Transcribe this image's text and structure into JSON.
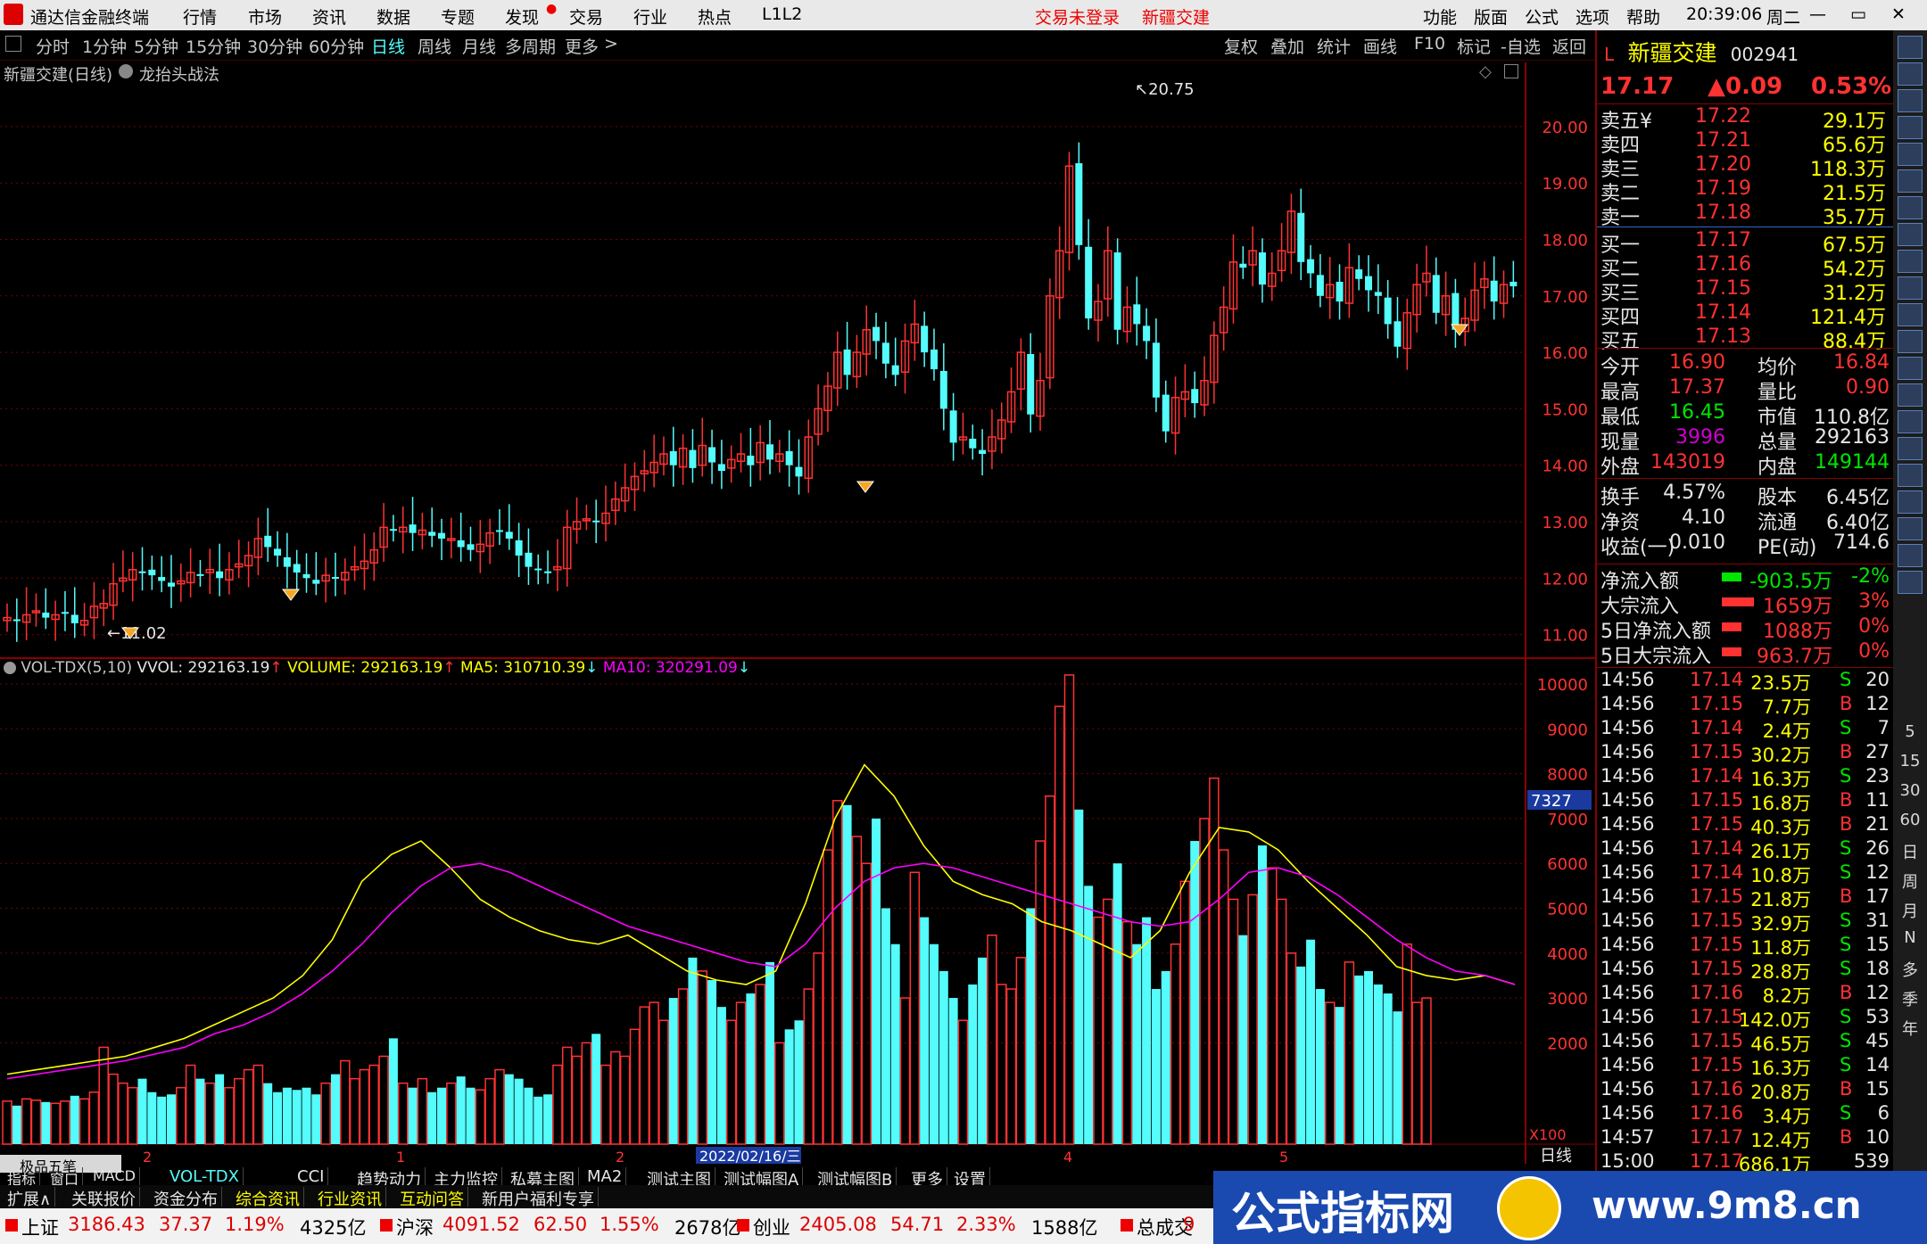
{
  "menu": {
    "title": "通达信金融终端",
    "items": [
      "行情",
      "市场",
      "资讯",
      "数据",
      "专题",
      "发现",
      "交易",
      "行业",
      "热点",
      "L1L2"
    ],
    "center": [
      "交易未登录",
      "新疆交建"
    ],
    "right": [
      "功能",
      "版面",
      "公式",
      "选项",
      "帮助"
    ],
    "time": "20:39:06",
    "weekday": "周二",
    "win_buttons": [
      "—",
      "▭",
      "✕"
    ]
  },
  "toolbar": {
    "periods": [
      "分时",
      "1分钟",
      "5分钟",
      "15分钟",
      "30分钟",
      "60分钟",
      "日线",
      "周线",
      "月线",
      "多周期",
      "更多"
    ],
    "active": "日线",
    "more_arrow": ">",
    "buttons": [
      "复权",
      "叠加",
      "统计",
      "画线",
      "F10",
      "标记",
      "-自选",
      "返回"
    ]
  },
  "chart_info": {
    "name": "新疆交建(日线)",
    "indicator": "龙抬头战法"
  },
  "chart_data": {
    "type": "candlestick",
    "price_axis": {
      "ticks": [
        11.0,
        12.0,
        13.0,
        14.0,
        15.0,
        16.0,
        17.0,
        18.0,
        19.0,
        20.0
      ],
      "tick_labels": [
        "11.00",
        "12.00",
        "13.00",
        "14.00",
        "15.00",
        "16.00",
        "17.00",
        "18.00",
        "19.00",
        "20.00"
      ]
    },
    "high_marker": "20.75",
    "low_marker": "11.02",
    "close": [
      11.3,
      11.25,
      11.35,
      11.42,
      11.3,
      11.35,
      11.38,
      11.2,
      11.25,
      11.5,
      11.55,
      11.9,
      12.0,
      12.15,
      12.1,
      12.05,
      11.95,
      11.85,
      11.95,
      12.1,
      12.05,
      12.15,
      12.0,
      12.15,
      12.25,
      12.4,
      12.7,
      12.55,
      12.4,
      12.2,
      12.1,
      12.0,
      11.9,
      12.05,
      12.0,
      12.1,
      12.2,
      12.3,
      12.5,
      12.9,
      12.85,
      12.9,
      12.8,
      12.85,
      12.75,
      12.7,
      12.7,
      12.55,
      12.5,
      12.6,
      12.8,
      12.85,
      12.7,
      12.4,
      12.2,
      12.15,
      12.1,
      12.2,
      12.9,
      13.0,
      13.05,
      13.0,
      13.15,
      13.4,
      13.6,
      13.8,
      13.9,
      14.05,
      14.2,
      14.0,
      14.3,
      13.95,
      14.35,
      14.05,
      13.9,
      14.1,
      14.2,
      14.0,
      14.4,
      14.1,
      14.2,
      14.0,
      13.8,
      14.5,
      15.0,
      15.4,
      16.0,
      15.6,
      16.0,
      16.4,
      16.2,
      15.8,
      15.6,
      16.2,
      16.5,
      16.0,
      15.7,
      15.0,
      14.4,
      14.5,
      14.3,
      14.2,
      14.5,
      14.8,
      15.3,
      16.0,
      14.9,
      15.5,
      17.0,
      17.8,
      19.3,
      17.9,
      16.6,
      16.9,
      17.8,
      16.4,
      16.8,
      16.5,
      16.2,
      15.2,
      14.6,
      15.2,
      15.3,
      15.1,
      15.5,
      16.3,
      16.8,
      17.6,
      17.5,
      17.8,
      17.2,
      17.4,
      17.8,
      18.5,
      17.6,
      17.4,
      17.0,
      17.2,
      16.9,
      17.5,
      17.3,
      17.1,
      17.0,
      16.5,
      16.1,
      16.7,
      17.2,
      17.4,
      16.7,
      17.0,
      16.4,
      16.6,
      17.1,
      17.3,
      16.9,
      17.2,
      17.17
    ],
    "volume_axis": {
      "ticks": [
        2000,
        3000,
        4000,
        5000,
        6000,
        7000,
        8000,
        9000,
        10000
      ],
      "tick_labels": [
        "2000",
        "3000",
        "4000",
        "5000",
        "6000",
        "7000",
        "8000",
        "9000",
        "10000"
      ],
      "unit_label": "X100",
      "cursor_label": "7327"
    },
    "volume": [
      700,
      600,
      750,
      720,
      680,
      650,
      700,
      820,
      750,
      900,
      1900,
      1300,
      1100,
      1000,
      1200,
      900,
      800,
      850,
      1000,
      1500,
      1200,
      1100,
      1300,
      1000,
      1200,
      1400,
      1500,
      1100,
      900,
      1000,
      950,
      1000,
      850,
      1100,
      1300,
      1600,
      1200,
      1400,
      1500,
      1700,
      2100,
      1100,
      1000,
      1200,
      900,
      1000,
      1100,
      1250,
      1000,
      950,
      1200,
      1400,
      1300,
      1200,
      1000,
      800,
      850,
      1500,
      1900,
      1700,
      2000,
      2200,
      1500,
      1800,
      1700,
      2300,
      2800,
      2900,
      2500,
      3000,
      3200,
      3900,
      3600,
      3400,
      2800,
      2500,
      2900,
      3100,
      3300,
      3800,
      2000,
      2300,
      2500,
      3200,
      4000,
      6300,
      7400,
      7300,
      6600,
      6000,
      7000,
      5000,
      4200,
      3000,
      5800,
      4800,
      4200,
      3600,
      3000,
      2500,
      3300,
      3900,
      4400,
      3300,
      3200,
      3900,
      5000,
      6500,
      7500,
      9500,
      10200,
      7200,
      5500,
      4800,
      5200,
      6000,
      4700,
      4200,
      4800,
      3200,
      3600,
      4200,
      5600,
      6500,
      7000,
      7900,
      6300,
      5200,
      4400,
      5300,
      6400,
      5900,
      5200,
      4000,
      3700,
      4300,
      3200,
      2900,
      2800,
      3800,
      3500,
      3600,
      3300,
      3100,
      2700,
      4200,
      2900,
      3000
    ],
    "vol_line_5": [
      1300,
      1400,
      1500,
      1600,
      1700,
      1900,
      2100,
      2400,
      2700,
      3000,
      3500,
      4300,
      5600,
      6200,
      6500,
      5900,
      5200,
      4800,
      4500,
      4300,
      4200,
      4400,
      4000,
      3600,
      3400,
      3300,
      3600,
      5100,
      7000,
      8200,
      7500,
      6400,
      5600,
      5300,
      5100,
      4700,
      4500,
      4200,
      3900,
      4500,
      5800,
      6800,
      6700,
      6300,
      5600,
      5000,
      4400,
      3700,
      3500,
      3400,
      3500,
      3300
    ],
    "vol_line_10": [
      1200,
      1300,
      1400,
      1500,
      1600,
      1750,
      1900,
      2200,
      2400,
      2700,
      3100,
      3600,
      4200,
      4900,
      5500,
      5900,
      6000,
      5800,
      5500,
      5200,
      4900,
      4600,
      4400,
      4200,
      4000,
      3800,
      3700,
      4200,
      5000,
      5600,
      5900,
      6000,
      5900,
      5700,
      5500,
      5300,
      5100,
      4900,
      4700,
      4600,
      4700,
      5200,
      5800,
      5900,
      5700,
      5300,
      4800,
      4300,
      3900,
      3600,
      3500,
      3300
    ],
    "x_axis_labels": [
      "2",
      "1",
      "2",
      "4",
      "5"
    ],
    "cursor_date": "2022/02/16/三",
    "period_label": "日线"
  },
  "volume_header": {
    "name": "VOL-TDX(5,10)",
    "vvol_label": "VVOL:",
    "vvol": "292163.19",
    "volume_label": "VOLUME:",
    "volume": "292163.19",
    "ma5_label": "MA5:",
    "ma5": "310710.39",
    "ma10_label": "MA10:",
    "ma10": "320291.09",
    "arrow_up": "↑",
    "arrow_down": "↓"
  },
  "quote": {
    "marker": "L",
    "name": "新疆交建",
    "code": "002941",
    "price": "17.17",
    "change": "▲0.09",
    "pct": "0.53%",
    "asks": [
      {
        "label": "卖五",
        "sym": "¥",
        "price": "17.22",
        "vol": "29.1万"
      },
      {
        "label": "卖四",
        "sym": "",
        "price": "17.21",
        "vol": "65.6万"
      },
      {
        "label": "卖三",
        "sym": "",
        "price": "17.20",
        "vol": "118.3万"
      },
      {
        "label": "卖二",
        "sym": "",
        "price": "17.19",
        "vol": "21.5万"
      },
      {
        "label": "卖一",
        "sym": "",
        "price": "17.18",
        "vol": "35.7万"
      }
    ],
    "bids": [
      {
        "label": "买一",
        "price": "17.17",
        "vol": "67.5万"
      },
      {
        "label": "买二",
        "price": "17.16",
        "vol": "54.2万"
      },
      {
        "label": "买三",
        "price": "17.15",
        "vol": "31.2万"
      },
      {
        "label": "买四",
        "price": "17.14",
        "vol": "121.4万"
      },
      {
        "label": "买五",
        "price": "17.13",
        "vol": "88.4万"
      }
    ],
    "stats": [
      {
        "l1": "今开",
        "v1": "16.90",
        "l2": "均价",
        "v2": "16.84"
      },
      {
        "l1": "最高",
        "v1": "17.37",
        "l2": "量比",
        "v2": "0.90"
      },
      {
        "l1": "最低",
        "v1": "16.45",
        "l2": "市值",
        "v2": "110.8亿"
      },
      {
        "l1": "现量",
        "v1": "3996",
        "l2": "总量",
        "v2": "292163"
      },
      {
        "l1": "外盘",
        "v1": "143019",
        "l2": "内盘",
        "v2": "149144"
      }
    ],
    "stats2": [
      {
        "l1": "换手",
        "v1": "4.57%",
        "l2": "股本",
        "v2": "6.45亿"
      },
      {
        "l1": "净资",
        "v1": "4.10",
        "l2": "流通",
        "v2": "6.40亿"
      },
      {
        "l1": "收益(一)",
        "v1": "0.010",
        "l2": "PE(动)",
        "v2": "714.6"
      }
    ],
    "flows": [
      {
        "label": "净流入额",
        "value": "-903.5万",
        "pct": "-2%"
      },
      {
        "label": "大宗流入",
        "value": "1659万",
        "pct": "3%"
      },
      {
        "label": "5日净流入额",
        "value": "1088万",
        "pct": "0%"
      },
      {
        "label": "5日大宗流入",
        "value": "963.7万",
        "pct": "0%"
      }
    ],
    "ticks": [
      [
        "14:56",
        "17.14",
        "23.5万",
        "S",
        "20"
      ],
      [
        "14:56",
        "17.15",
        "7.7万",
        "B",
        "12"
      ],
      [
        "14:56",
        "17.14",
        "2.4万",
        "S",
        "7"
      ],
      [
        "14:56",
        "17.15",
        "30.2万",
        "B",
        "27"
      ],
      [
        "14:56",
        "17.14",
        "16.3万",
        "S",
        "23"
      ],
      [
        "14:56",
        "17.15",
        "16.8万",
        "B",
        "11"
      ],
      [
        "14:56",
        "17.15",
        "40.3万",
        "B",
        "21"
      ],
      [
        "14:56",
        "17.14",
        "26.1万",
        "S",
        "26"
      ],
      [
        "14:56",
        "17.14",
        "10.8万",
        "S",
        "12"
      ],
      [
        "14:56",
        "17.15",
        "21.8万",
        "B",
        "17"
      ],
      [
        "14:56",
        "17.15",
        "32.9万",
        "S",
        "31"
      ],
      [
        "14:56",
        "17.15",
        "11.8万",
        "S",
        "15"
      ],
      [
        "14:56",
        "17.15",
        "28.8万",
        "S",
        "18"
      ],
      [
        "14:56",
        "17.16",
        "8.2万",
        "B",
        "12"
      ],
      [
        "14:56",
        "17.15",
        "142.0万",
        "S",
        "53"
      ],
      [
        "14:56",
        "17.15",
        "46.5万",
        "S",
        "45"
      ],
      [
        "14:56",
        "17.15",
        "16.3万",
        "S",
        "14"
      ],
      [
        "14:56",
        "17.16",
        "20.8万",
        "B",
        "15"
      ],
      [
        "14:56",
        "17.16",
        "3.4万",
        "S",
        "6"
      ],
      [
        "14:57",
        "17.17",
        "12.4万",
        "B",
        "10"
      ],
      [
        "15:00",
        "17.17",
        "686.1万",
        "",
        "539"
      ]
    ]
  },
  "sidebar": {
    "text_items": [
      "5",
      "15",
      "30",
      "60",
      "日",
      "周",
      "月",
      "N",
      "多",
      "季",
      "年"
    ],
    "icons": [
      "chevron-up",
      "chevron-up",
      "chevron-down",
      "grid",
      "bar",
      "line",
      "candle",
      "list",
      "f10",
      "chart",
      "heat",
      "f2",
      "f3",
      "clock",
      "chart",
      "rsi",
      "flag",
      "move",
      "pen",
      "fs",
      "list"
    ]
  },
  "bottom_tabs": {
    "items": [
      "指标",
      "窗口",
      "MACD",
      "VOL-TDX",
      "CCI",
      "趋势动力",
      "主力监控",
      "私募主图",
      "MA2",
      "测试主图",
      "测试幅图A",
      "测试幅图B",
      "更多",
      "设置"
    ],
    "active": "VOL-TDX",
    "quickbar": "极品五笔"
  },
  "bottom_tabs2": {
    "items": [
      "扩展∧",
      "关联报价",
      "资金分布",
      "综合资讯",
      "行业资讯",
      "互动问答",
      "新用户福利专享"
    ]
  },
  "status": [
    {
      "name": "上证",
      "value": "3186.43",
      "chg": "37.37",
      "pct": "1.19%",
      "amt": "4325亿"
    },
    {
      "name": "沪深",
      "value": "4091.52",
      "chg": "62.50",
      "pct": "1.55%",
      "amt": "2678亿"
    },
    {
      "name": "创业",
      "value": "2405.08",
      "chg": "54.71",
      "pct": "2.33%",
      "amt": "1588亿"
    },
    {
      "name": "总成交",
      "value": "9",
      "chg": "",
      "pct": "",
      "amt": ""
    }
  ],
  "banner": {
    "text": "公式指标网",
    "url": "www.9m8.cn"
  },
  "colors": {
    "up": "#ff3232",
    "down": "#54fcfc",
    "grid": "#7a0000",
    "ma5": "#ffff00",
    "ma10": "#ff00ff"
  }
}
